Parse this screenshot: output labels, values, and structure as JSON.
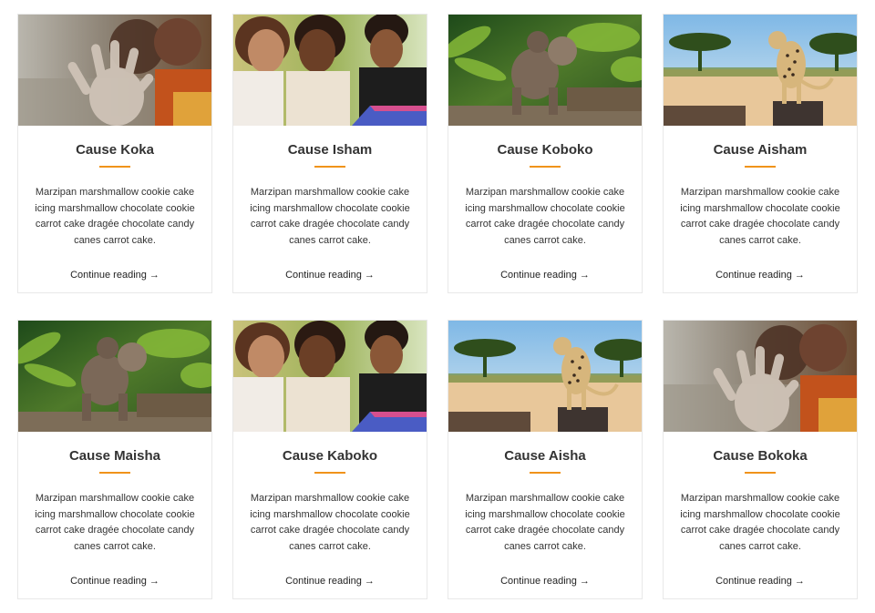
{
  "causes": [
    {
      "title": "Cause Koka",
      "image": "hand-boy-photo",
      "description": "Marzipan marshmallow cookie cake icing marshmallow chocolate cookie carrot cake dragée chocolate candy canes carrot cake.",
      "link_label": "Continue reading",
      "arrow": "→"
    },
    {
      "title": "Cause Isham",
      "image": "children-reading-photo",
      "description": "Marzipan marshmallow cookie cake icing marshmallow chocolate cookie carrot cake dragée chocolate candy canes carrot cake.",
      "link_label": "Continue reading",
      "arrow": "→"
    },
    {
      "title": "Cause Koboko",
      "image": "monkey-jungle-photo",
      "description": "Marzipan marshmallow cookie cake icing marshmallow chocolate cookie carrot cake dragée chocolate candy canes carrot cake.",
      "link_label": "Continue reading",
      "arrow": "→"
    },
    {
      "title": "Cause Aisham",
      "image": "cheetah-savanna-photo",
      "description": "Marzipan marshmallow cookie cake icing marshmallow chocolate cookie carrot cake dragée chocolate candy canes carrot cake.",
      "link_label": "Continue reading",
      "arrow": "→"
    },
    {
      "title": "Cause Maisha",
      "image": "monkey-jungle-photo",
      "description": "Marzipan marshmallow cookie cake icing marshmallow chocolate cookie carrot cake dragée chocolate candy canes carrot cake.",
      "link_label": "Continue reading",
      "arrow": "→"
    },
    {
      "title": "Cause Kaboko",
      "image": "children-reading-photo",
      "description": "Marzipan marshmallow cookie cake icing marshmallow chocolate cookie carrot cake dragée chocolate candy canes carrot cake.",
      "link_label": "Continue reading",
      "arrow": "→"
    },
    {
      "title": "Cause Aisha",
      "image": "cheetah-savanna-photo",
      "description": "Marzipan marshmallow cookie cake icing marshmallow chocolate cookie carrot cake dragée chocolate candy canes carrot cake.",
      "link_label": "Continue reading",
      "arrow": "→"
    },
    {
      "title": "Cause Bokoka",
      "image": "hand-boy-photo",
      "description": "Marzipan marshmallow cookie cake icing marshmallow chocolate cookie carrot cake dragée chocolate candy canes carrot cake.",
      "link_label": "Continue reading",
      "arrow": "→"
    }
  ],
  "colors": {
    "accent": "#f0931a",
    "text": "#333333",
    "card_border": "#e8e8e8"
  }
}
